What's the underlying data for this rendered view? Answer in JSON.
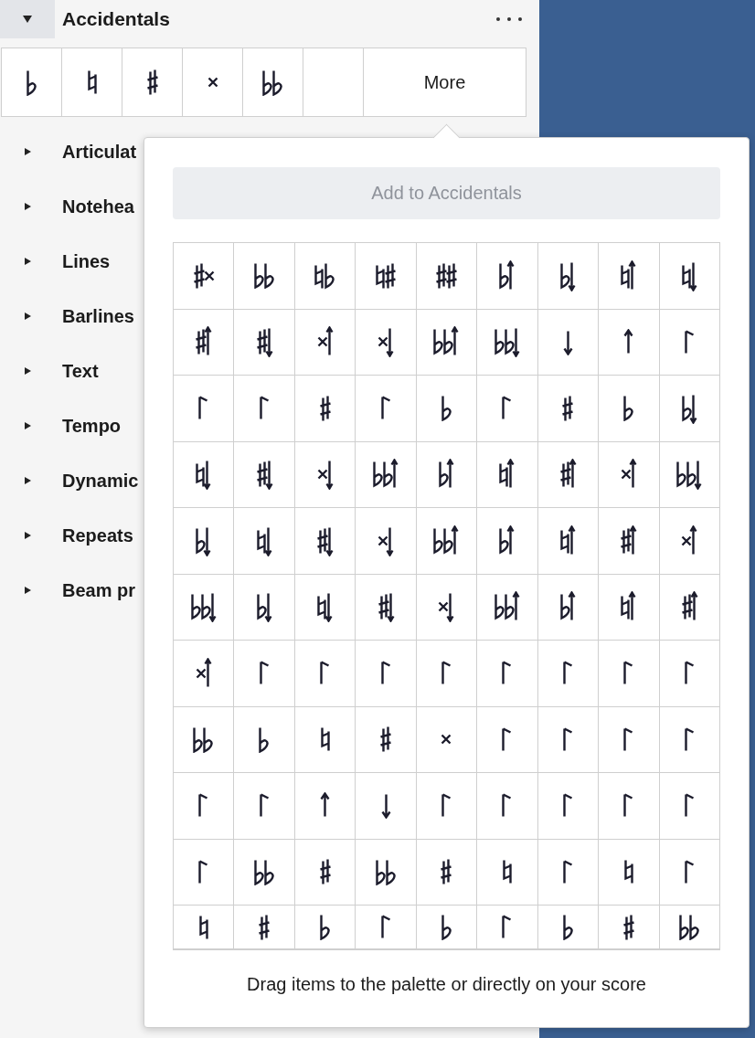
{
  "panel": {
    "title": "Accidentals",
    "expanded": true,
    "more": "More"
  },
  "palettes": [
    {
      "label": "Articulat",
      "expanded": false
    },
    {
      "label": "Notehea",
      "expanded": false
    },
    {
      "label": "Lines",
      "expanded": false
    },
    {
      "label": "Barlines",
      "expanded": false
    },
    {
      "label": "Text",
      "expanded": false
    },
    {
      "label": "Tempo",
      "expanded": false
    },
    {
      "label": "Dynamic",
      "expanded": false
    },
    {
      "label": "Repeats",
      "expanded": false
    },
    {
      "label": "Beam pr",
      "expanded": false
    }
  ],
  "popup": {
    "button": "Add to Accidentals",
    "button_disabled": true,
    "hint": "Drag items to the palette or directly on your score"
  }
}
